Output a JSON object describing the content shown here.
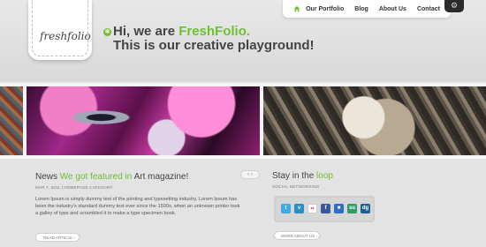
{
  "header": {
    "logo_text": "freshfolio",
    "logo_badge": "✱",
    "headline_intro": "Hi, we are ",
    "headline_brand": "FreshFolio.",
    "headline_line2": "This is our creative playground!"
  },
  "nav": {
    "items": [
      "Our Portfolio",
      "Blog",
      "About Us",
      "Contact"
    ],
    "home_icon": "home-icon",
    "settings_icon": "gear-icon"
  },
  "news": {
    "title_prefix": "News ",
    "title_accent": "We got featured in ",
    "title_end": "Art magazine!",
    "meta": "MAR 7, 2011 | HOMEPAGE CATEGORY",
    "body": "Lorem Ipsum is simply dummy text of the printing and typesetting industry. Lorem Ipsum has been the industry's standard dummy text ever since the 1500s, when an unknown printer took a galley of type and scrambled it to make a type specimen book.",
    "read_more": "READ ARTICLE"
  },
  "slider_nav": "‹ ›",
  "social": {
    "title_prefix": "Stay in the ",
    "title_accent": "loop",
    "label": "SOCIAL NETWORKING",
    "icons": [
      {
        "name": "twitter-icon",
        "glyph": "t",
        "color": "#3fa9e0"
      },
      {
        "name": "vimeo-icon",
        "glyph": "v",
        "color": "#2a8fc5"
      },
      {
        "name": "flickr-icon",
        "glyph": "••",
        "color": "#ffffff"
      },
      {
        "name": "facebook-icon",
        "glyph": "f",
        "color": "#3b5998"
      },
      {
        "name": "delicious-icon",
        "glyph": "■",
        "color": "#2d6cc9"
      },
      {
        "name": "stumbleupon-icon",
        "glyph": "su",
        "color": "#2e9c6a"
      },
      {
        "name": "digg-icon",
        "glyph": "dg",
        "color": "#1d5e96"
      }
    ],
    "more_about": "MORE ABOUT US"
  },
  "colors": {
    "accent": "#6fbf2e",
    "text": "#444444"
  }
}
